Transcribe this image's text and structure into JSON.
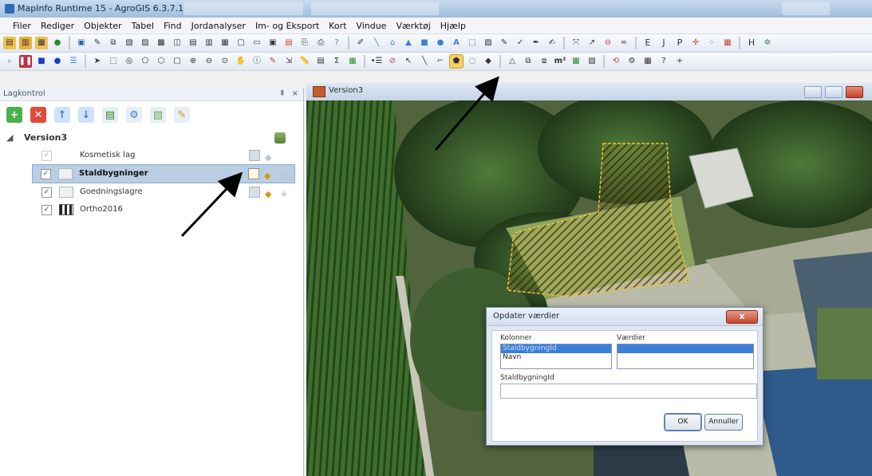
{
  "window": {
    "title": "MapInfo Runtime 15 - AgroGIS 6.3.7.1"
  },
  "menu": [
    "Filer",
    "Rediger",
    "Objekter",
    "Tabel",
    "Find",
    "Jordanalyser",
    "Im- og Eksport",
    "Kort",
    "Vindue",
    "Værktøj",
    "Hjælp"
  ],
  "toolbar1_letters": [
    "E",
    "J",
    "P",
    "H"
  ],
  "layer_panel": {
    "title": "Lagkontrol",
    "root": "Version3",
    "layers": [
      {
        "name": "Kosmetisk lag",
        "checked": true,
        "selected": false
      },
      {
        "name": "Staldbygninger",
        "checked": true,
        "selected": true
      },
      {
        "name": "Goedningslagre",
        "checked": true,
        "selected": false
      },
      {
        "name": "Ortho2016",
        "checked": true,
        "selected": false
      }
    ]
  },
  "map_window": {
    "title": "Version3"
  },
  "dialog": {
    "title": "Opdater værdier",
    "columns_label": "Kolonner",
    "values_label": "Værdier",
    "columns": [
      "StaldbygningId",
      "Navn"
    ],
    "selected_column": "StaldbygningId",
    "field_label": "StaldbygningId",
    "field_value": "",
    "ok_label": "OK",
    "cancel_label": "Annuller",
    "close_label": "x"
  },
  "colors": {
    "accent": "#3c7fd8",
    "hatch": "#f0c23a",
    "active_tool": "#f6d169"
  }
}
